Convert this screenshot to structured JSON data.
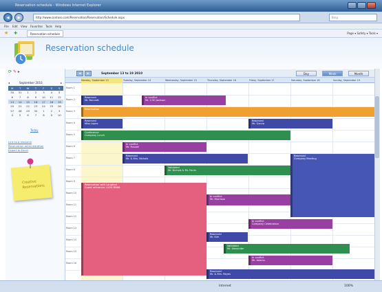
{
  "browser": {
    "window_title": "Reservation schedule - Windows Internet Explorer",
    "url": "http://www.contoso.com/Reservation/Reservation/Schedule.aspx",
    "search_placeholder": "Bing",
    "menu": [
      "File",
      "Edit",
      "View",
      "Favorites",
      "Tools",
      "Help"
    ],
    "tab_label": "Reservation schedule",
    "toolbar_items": "Page ▾  Safety ▾  Tools ▾",
    "status_zone": "Internet",
    "zoom": "100%"
  },
  "page": {
    "title": "Reservation schedule"
  },
  "left": {
    "month_label": "September 2010",
    "prev": "◂",
    "next": "▸",
    "weekdays": [
      "M",
      "T",
      "W",
      "T",
      "F",
      "S",
      "S"
    ],
    "weeks": [
      [
        "30",
        "31",
        "1",
        "2",
        "3",
        "4",
        "5"
      ],
      [
        "6",
        "7",
        "8",
        "9",
        "10",
        "11",
        "12"
      ],
      [
        "13",
        "14",
        "15",
        "16",
        "17",
        "18",
        "19"
      ],
      [
        "20",
        "21",
        "22",
        "23",
        "24",
        "25",
        "26"
      ],
      [
        "27",
        "28",
        "29",
        "30",
        "1",
        "2",
        "3"
      ],
      [
        "4",
        "5",
        "6",
        "7",
        "8",
        "9",
        "10"
      ]
    ],
    "today_label": "Today",
    "links": [
      "Link to a resource",
      "Reservation administration",
      "Export to Excel"
    ],
    "note_text": "Creative Reservations"
  },
  "schedule": {
    "range_label": "September 13 to 19 2010",
    "views": [
      "Day",
      "Week",
      "Month"
    ],
    "days": [
      "Monday, September 13",
      "Tuesday, September 14",
      "Wednesday, September 15",
      "Thursday, September 16",
      "Friday, September 17",
      "Saturday, September 18",
      "Sunday, September 19"
    ],
    "rooms": [
      "Room 1",
      "Room 2",
      "Room 3",
      "Room 4",
      "Room 5",
      "Room 6",
      "Room 7",
      "Room 8",
      "Room 9",
      "Room 10",
      "Room 11",
      "Room 12",
      "Room 13",
      "Room 14",
      "Room 15",
      "Room 16"
    ],
    "events": [
      {
        "label": "Reserved",
        "sub": "Mr. Bennett",
        "color": "navy"
      },
      {
        "label": "In conflict",
        "sub": "Mr. 2:30 Jackson",
        "color": "purple"
      },
      {
        "label": "Reservation",
        "sub": "",
        "color": "orange"
      },
      {
        "label": "Reserved",
        "sub": "Miss Lopez",
        "color": "navy"
      },
      {
        "label": "Reserved",
        "sub": "Mr. Garcia",
        "color": "navy"
      },
      {
        "label": "Conference",
        "sub": "Company Lunch",
        "color": "green"
      },
      {
        "label": "In conflict",
        "sub": "Mr. Russell",
        "color": "purple"
      },
      {
        "label": "Reserved",
        "sub": "Mr. & Mrs. Nichols",
        "color": "navy"
      },
      {
        "label": "Reserved",
        "sub": "Company Meeting",
        "color": "blue"
      },
      {
        "label": "Validated",
        "sub": "Mr. Nichols & Mr. Ferris",
        "color": "green"
      },
      {
        "label": "Reservation with Longtext",
        "sub": "Guest reference: 4420-RN66",
        "color": "pink"
      },
      {
        "label": "In conflict",
        "sub": "Mr. Morrison",
        "color": "purple"
      },
      {
        "label": "In conflict",
        "sub": "Company Celebration",
        "color": "purple"
      },
      {
        "label": "Reserved",
        "sub": "Mr. Kim",
        "color": "navy"
      },
      {
        "label": "Validated",
        "sub": "Mr. Alexander",
        "color": "green"
      },
      {
        "label": "In conflict",
        "sub": "Mr. Adams",
        "color": "purple"
      },
      {
        "label": "Reserved",
        "sub": "Mr. & Mrs. Reyes",
        "color": "navy"
      }
    ]
  }
}
